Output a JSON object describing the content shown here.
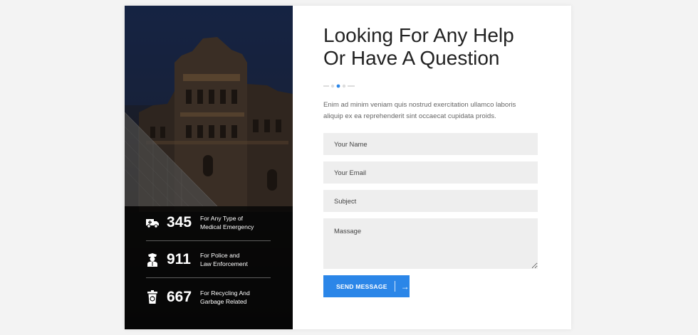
{
  "contact": {
    "title_line1": "Looking For Any Help",
    "title_line2": "Or Have A Question",
    "description": "Enim ad minim veniam quis nostrud exercitation ullamco laboris aliquip ex ea reprehenderit sint occaecat cupidata proids.",
    "fields": {
      "name_placeholder": "Your Name",
      "email_placeholder": "Your Email",
      "subject_placeholder": "Subject",
      "message_placeholder": "Massage"
    },
    "send_label": "SEND MESSAGE",
    "send_arrow": "→"
  },
  "stats": [
    {
      "icon": "ambulance-icon",
      "number": "345",
      "line1": "For Any Type of",
      "line2": "Medical Emergency"
    },
    {
      "icon": "police-officer-icon",
      "number": "911",
      "line1": "For Police and",
      "line2": "Law Enforcement"
    },
    {
      "icon": "recycle-bin-icon",
      "number": "667",
      "line1": "For Recycling And",
      "line2": "Garbage Related"
    }
  ],
  "colors": {
    "accent": "#2b86e8",
    "field_bg": "#eeeeee",
    "title_text": "#222222"
  }
}
